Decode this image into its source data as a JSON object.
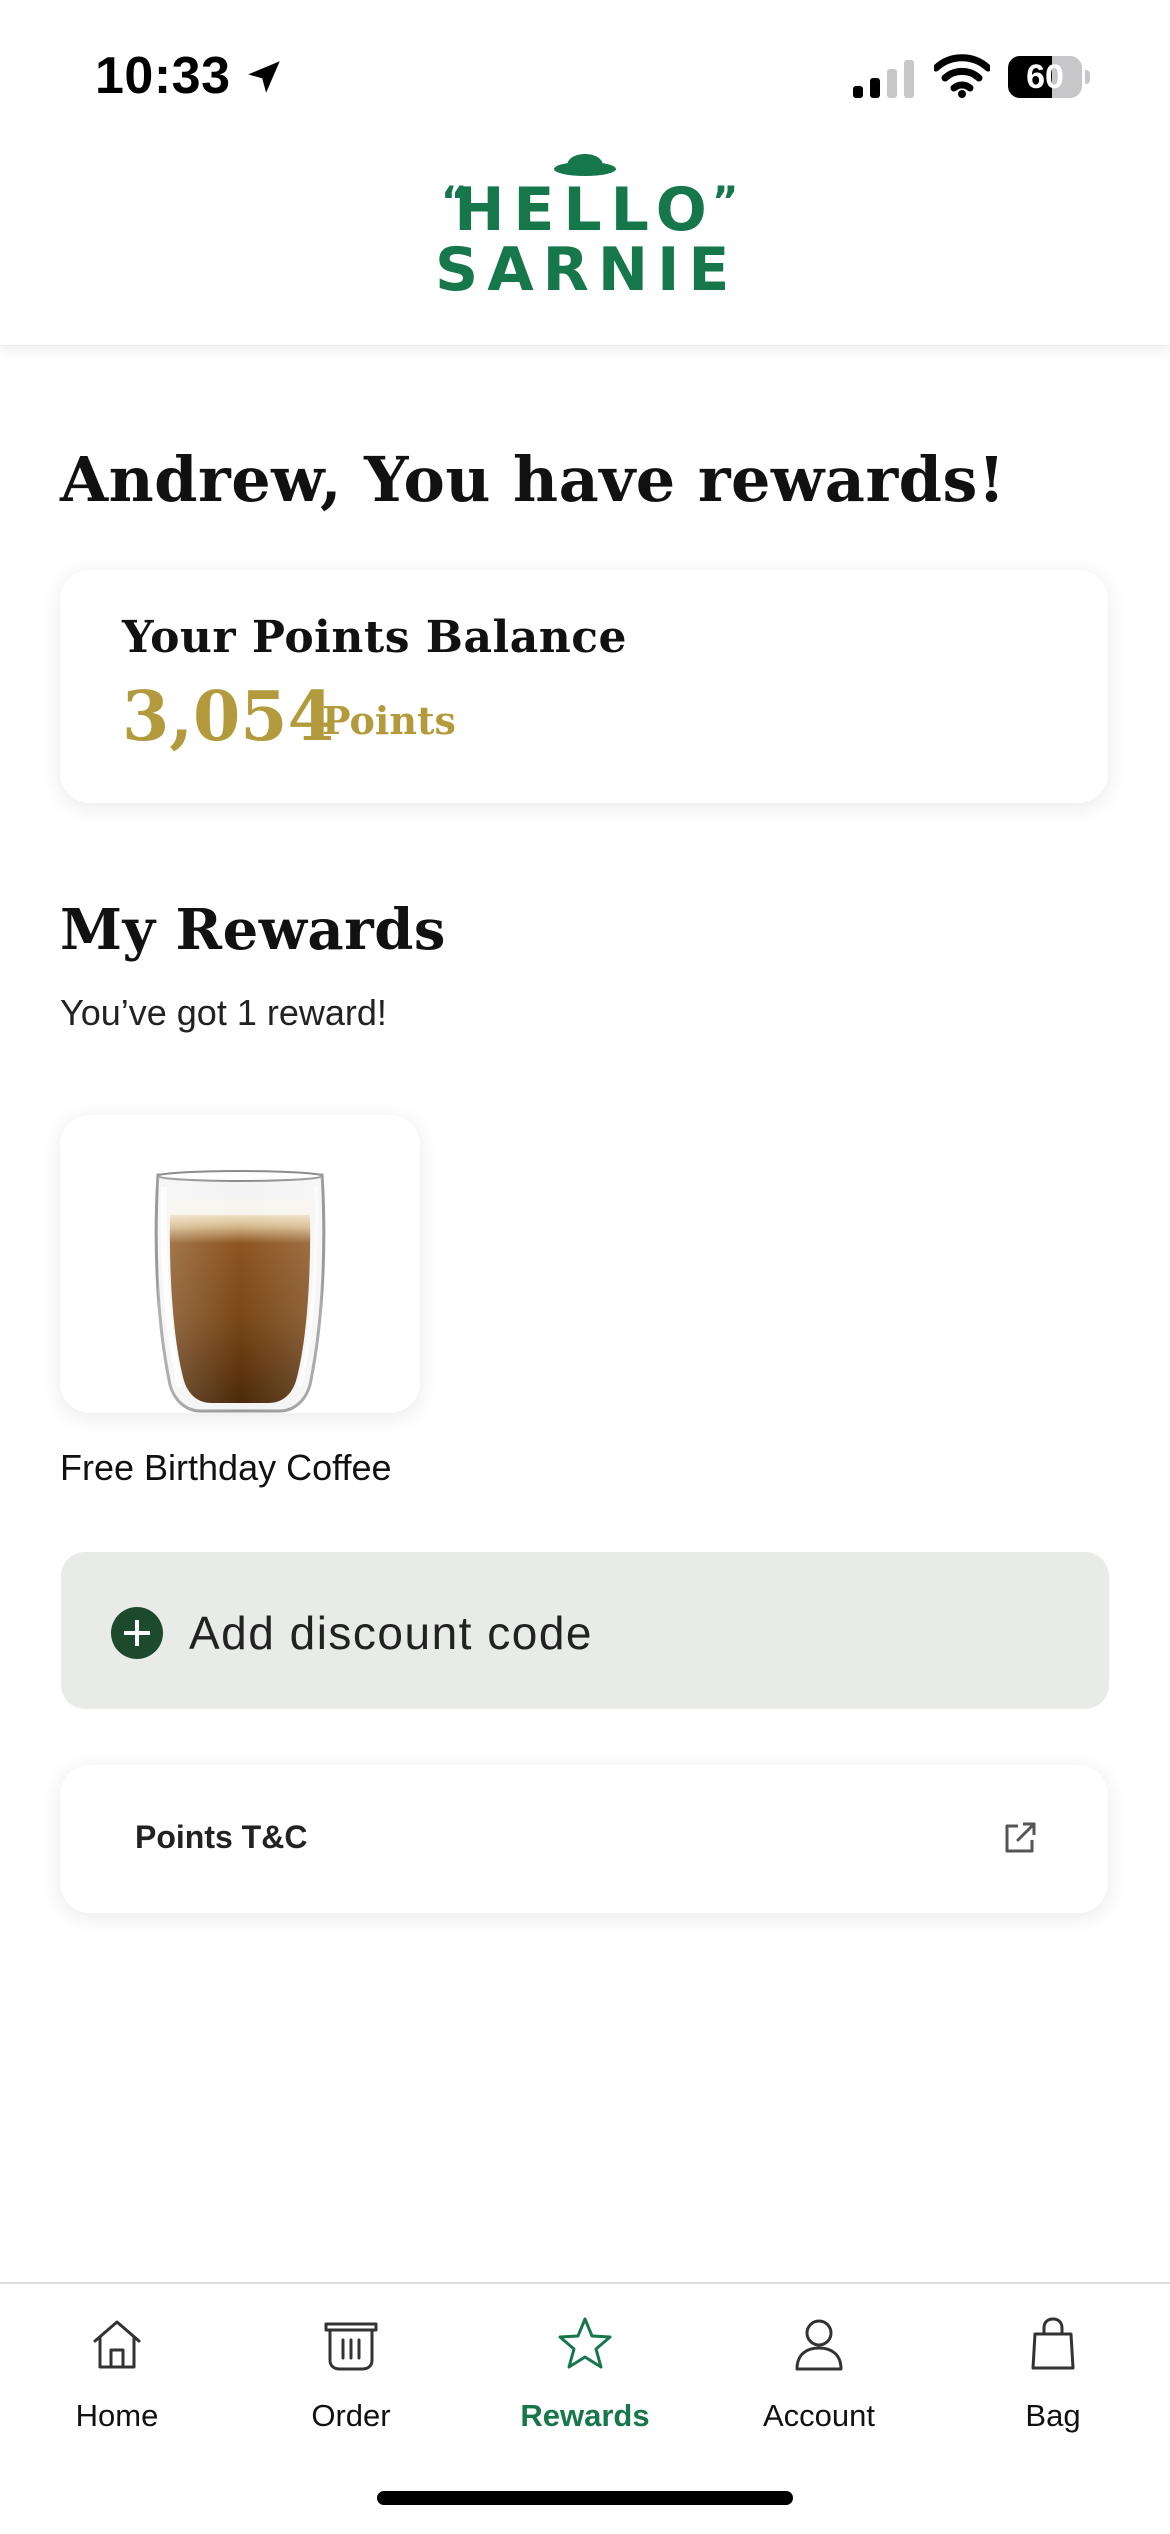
{
  "status_bar": {
    "time": "10:33",
    "battery_level": 60,
    "battery_text": "60",
    "icons": [
      "location-arrow-icon",
      "cellular-signal-icon",
      "wifi-icon",
      "battery-icon"
    ]
  },
  "header": {
    "logo_line_1": "HELLO",
    "logo_line_2": "SARNIE",
    "logo_quote_open": "“",
    "logo_quote_close": "”",
    "logo_color": "#15774a"
  },
  "main": {
    "greeting": "Andrew, You have rewards!",
    "points": {
      "title": "Your Points Balance",
      "value": "3,054",
      "unit": "Points",
      "color": "#b39a3c"
    },
    "rewards": {
      "heading": "My Rewards",
      "subtitle": "You’ve got 1 reward!",
      "items": [
        {
          "label": "Free Birthday Coffee",
          "icon": "coffee-glass-image"
        }
      ]
    },
    "discount": {
      "label": "Add discount code",
      "icon": "plus-circle-icon"
    },
    "terms": {
      "label": "Points T&C",
      "icon": "external-link-icon"
    }
  },
  "bottom_nav": {
    "active": "Rewards",
    "accent": "#15774a",
    "items": [
      {
        "label": "Home",
        "icon": "home-icon"
      },
      {
        "label": "Order",
        "icon": "order-icon"
      },
      {
        "label": "Rewards",
        "icon": "star-icon"
      },
      {
        "label": "Account",
        "icon": "person-icon"
      },
      {
        "label": "Bag",
        "icon": "bag-icon"
      }
    ]
  }
}
